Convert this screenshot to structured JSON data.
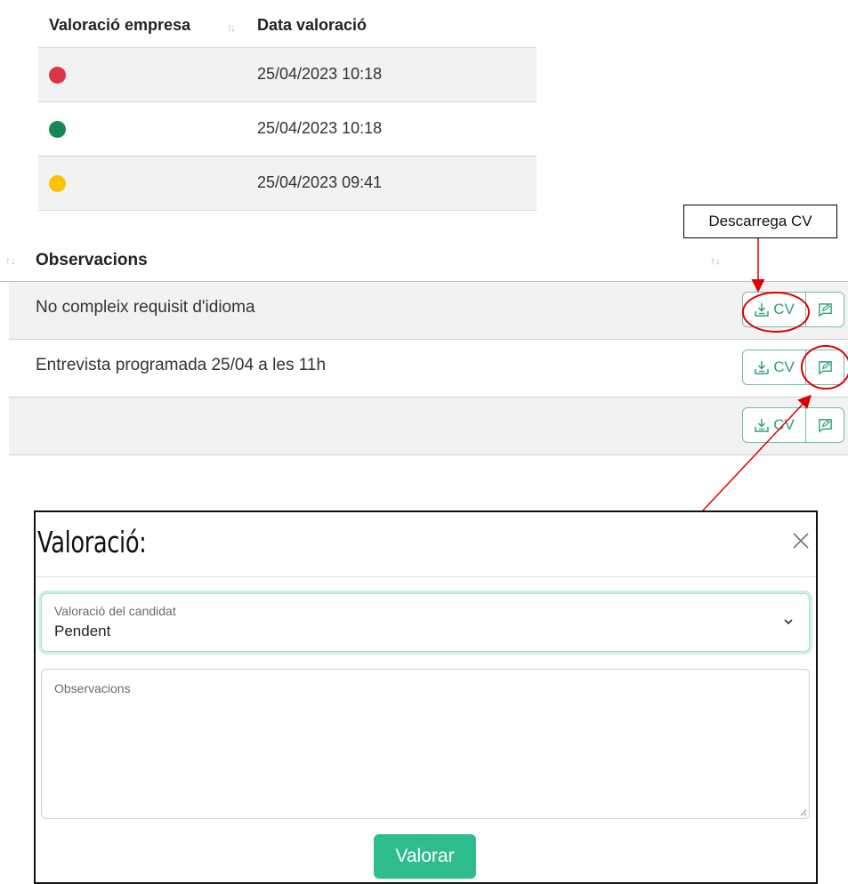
{
  "ratings_table": {
    "headers": {
      "company_rating": "Valoració empresa",
      "rating_date": "Data valoració",
      "sort_glyph": "↑↓"
    },
    "rows": [
      {
        "status_color": "#dc3545",
        "date": "25/04/2023 10:18"
      },
      {
        "status_color": "#198754",
        "date": "25/04/2023 10:18"
      },
      {
        "status_color": "#ffc107",
        "date": "25/04/2023 09:41"
      }
    ]
  },
  "observations_table": {
    "header": {
      "title": "Observacions",
      "sort_glyph": "↑↓"
    },
    "rows": [
      {
        "text": "No compleix requisit d'idioma",
        "cv_label": "CV"
      },
      {
        "text": "Entrevista programada 25/04 a les 11h",
        "cv_label": "CV"
      },
      {
        "text": "",
        "cv_label": "CV"
      }
    ],
    "accent_color": "#2e9f7c"
  },
  "callout": {
    "label": "Descarrega CV",
    "arrow_color": "#e00000"
  },
  "modal": {
    "title": "Valoració:",
    "close_icon": "close-icon",
    "select": {
      "label": "Valoració del candidat",
      "value": "Pendent"
    },
    "textarea": {
      "label": "Observacions"
    },
    "submit_label": "Valorar",
    "submit_color": "#2ebd8b"
  }
}
